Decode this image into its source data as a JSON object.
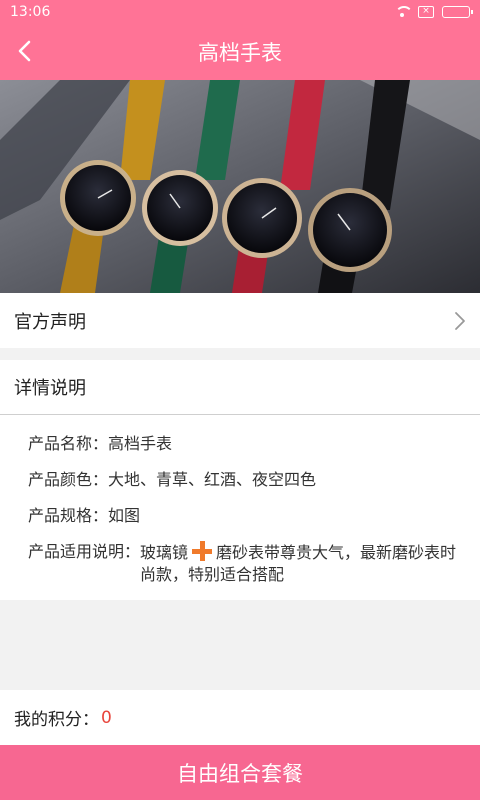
{
  "status_bar": {
    "time": "13:06",
    "icons": [
      "wifi-icon",
      "sim-icon",
      "battery-icon"
    ]
  },
  "nav": {
    "title": "高档手表",
    "back_icon": "chevron-left-icon"
  },
  "hero": {
    "image": "product-photo-watches"
  },
  "notice_row": {
    "label": "官方声明",
    "icon": "chevron-right-icon"
  },
  "details": {
    "header": "详情说明",
    "specs": [
      {
        "key": "产品名称：",
        "value": "高档手表"
      },
      {
        "key": "产品颜色：",
        "value": "大地、青草、红酒、夜空四色"
      },
      {
        "key": "产品规格：",
        "value": "如图"
      },
      {
        "key": "产品适用说明：",
        "value_part1": "玻璃镜",
        "value_icon": "plus-icon",
        "value_part2": "磨砂表带尊贵大气，最新磨砂表时尚款，特别适合搭配"
      }
    ]
  },
  "points": {
    "label": "我的积分：",
    "value": "0"
  },
  "bottom_button": {
    "label": "自由组合套餐"
  },
  "colors": {
    "brand_pink": "#ff7396",
    "button_pink": "#f76791",
    "points_red": "#e8453c",
    "plus_orange": "#f07a2b"
  }
}
